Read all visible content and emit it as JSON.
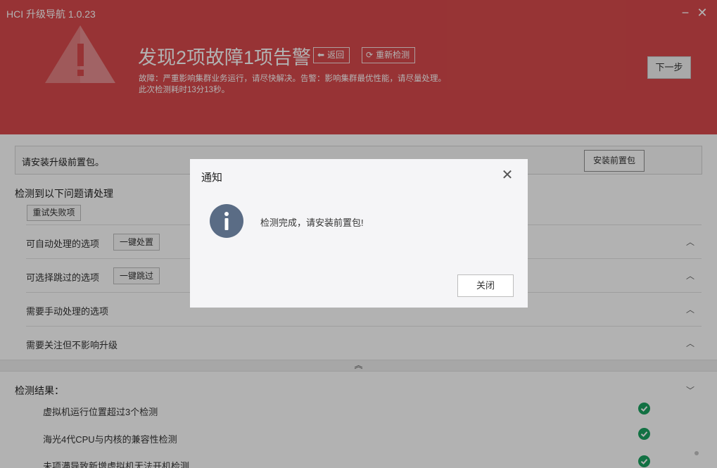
{
  "window": {
    "title": "HCI 升级导航 1.0.23",
    "minimize_icon": "minimize-icon",
    "close_icon": "close-icon"
  },
  "header": {
    "background_color": "#d94a4c",
    "headline": "发现2项故障1项告警",
    "back_label": "返回",
    "recheck_label": "重新检测",
    "description_line1": "故障：严重影响集群业务运行，请尽快解决。告警：影响集群最优性能，请尽量处理。",
    "description_line2": "此次检测耗时13分13秒。",
    "next_label": "下一步"
  },
  "notice": {
    "text": "请安装升级前置包。",
    "install_label": "安装前置包"
  },
  "issues": {
    "title": "检测到以下问题请处理",
    "retry_label": "重试失败项",
    "groups": [
      {
        "label": "可自动处理的选项",
        "action": "一键处置"
      },
      {
        "label": "可选择跳过的选项",
        "action": "一键跳过"
      },
      {
        "label": "需要手动处理的选项"
      },
      {
        "label": "需要关注但不影响升级"
      }
    ]
  },
  "results": {
    "title": "检测结果：",
    "items": [
      "虚拟机运行位置超过3个检测",
      "海光4代CPU与内核的兼容性检测",
      "未项满导致新增虚拟机无法开机检测"
    ],
    "ok_color": "#1aa260"
  },
  "dialog": {
    "title": "通知",
    "message": "检测完成，请安装前置包!",
    "close_label": "关闭",
    "icon": "info-icon"
  }
}
